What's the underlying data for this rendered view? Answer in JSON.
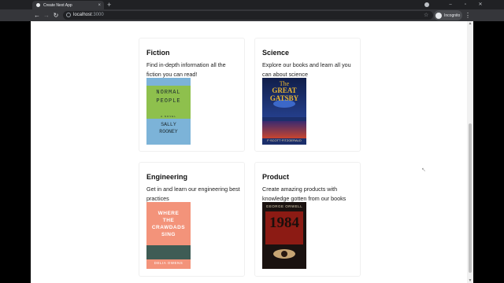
{
  "browser": {
    "tab_title": "Create Next App",
    "tab_close": "×",
    "new_tab": "+",
    "url_host": "localhost",
    "url_port": ":3000",
    "profile_label": "Incognito",
    "menu": "⋮",
    "back": "←",
    "forward": "→",
    "reload": "↻",
    "star": "☆",
    "minimize": "–",
    "maximize": "▫",
    "close": "✕"
  },
  "categories": [
    {
      "title": "Fiction",
      "description": "Find in-depth information all the fiction you can read!",
      "cover": {
        "line1": "NORMAL",
        "line2": "PEOPLE",
        "tag": "A NOVEL",
        "author_line1": "SALLY",
        "author_line2": "ROONEY"
      }
    },
    {
      "title": "Science",
      "description": "Explore our books and learn all you can about science",
      "cover": {
        "line1": "The",
        "line2": "GREAT GATSBY",
        "author": "F·SCOTT·FITZGERALD"
      }
    },
    {
      "title": "Engineering",
      "description": "Get in and learn our engineering best practices",
      "cover": {
        "line1": "WHERE",
        "line2": "THE",
        "line3": "CRAWDADS",
        "line4": "SING",
        "author": "DELIA OWENS"
      }
    },
    {
      "title": "Product",
      "description": "Create amazing products with knowledge gotten from our books",
      "cover": {
        "author": "GEORGE ORWELL",
        "title": "1984"
      }
    }
  ]
}
